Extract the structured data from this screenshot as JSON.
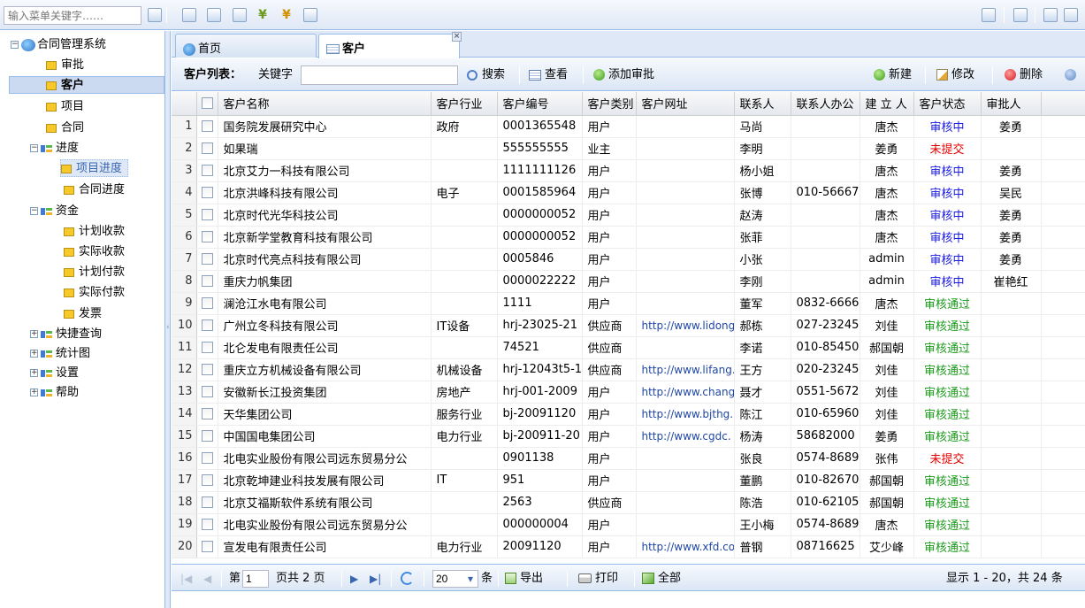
{
  "topbar": {
    "search_placeholder": "输入菜单关键字……"
  },
  "tree": {
    "root": "合同管理系统",
    "items": {
      "approval": "审批",
      "customer": "客户",
      "project": "项目",
      "contract": "合同",
      "progress": "进度",
      "project_progress": "项目进度",
      "contract_progress": "合同进度",
      "funds": "资金",
      "planned_receipt": "计划收款",
      "actual_receipt": "实际收款",
      "planned_payment": "计划付款",
      "actual_payment": "实际付款",
      "invoice": "发票",
      "quick_query": "快捷查询",
      "stats": "统计图",
      "settings": "设置",
      "help": "帮助"
    }
  },
  "tabs": {
    "home": "首页",
    "customer": "客户",
    "close_glyph": "×"
  },
  "gridbar": {
    "title": "客户列表：",
    "keyword_label": "关键字",
    "search": "搜索",
    "view": "查看",
    "add_approval": "添加审批",
    "create": "新建",
    "modify": "修改",
    "delete": "删除"
  },
  "grid": {
    "columns": [
      "客户名称",
      "客户行业",
      "客户编号",
      "客户类别",
      "客户网址",
      "联系人",
      "联系人办公",
      "建 立 人",
      "客户状态",
      "审批人"
    ],
    "rows": [
      [
        "国务院发展研究中心",
        "政府",
        "0001365548",
        "用户",
        "",
        "马尚",
        "",
        "唐杰",
        "审核中",
        "姜勇"
      ],
      [
        "如果瑞",
        "",
        "555555555",
        "业主",
        "",
        "李明",
        "",
        "姜勇",
        "未提交",
        ""
      ],
      [
        "北京艾力一科技有限公司",
        "",
        "1111111126",
        "用户",
        "",
        "杨小姐",
        "",
        "唐杰",
        "审核中",
        "姜勇"
      ],
      [
        "北京洪峰科技有限公司",
        "电子",
        "0001585964",
        "用户",
        "",
        "张博",
        "010-56667",
        "唐杰",
        "审核中",
        "吴民"
      ],
      [
        "北京时代光华科技公司",
        "",
        "0000000052",
        "用户",
        "",
        "赵涛",
        "",
        "唐杰",
        "审核中",
        "姜勇"
      ],
      [
        "北京新学堂教育科技有限公司",
        "",
        "0000000052",
        "用户",
        "",
        "张菲",
        "",
        "唐杰",
        "审核中",
        "姜勇"
      ],
      [
        "北京时代亮点科技有限公司",
        "",
        "0005846",
        "用户",
        "",
        "小张",
        "",
        "admin",
        "审核中",
        "姜勇"
      ],
      [
        "重庆力帆集团",
        "",
        "0000022222",
        "用户",
        "",
        "李刚",
        "",
        "admin",
        "审核中",
        "崔艳红"
      ],
      [
        "澜沧江水电有限公司",
        "",
        "1111",
        "用户",
        "",
        "董军",
        "0832-6666",
        "唐杰",
        "审核通过",
        ""
      ],
      [
        "广州立冬科技有限公司",
        "IT设备",
        "hrj-23025-21",
        "供应商",
        "http://www.lidong",
        "郝栋",
        "027-23245",
        "刘佳",
        "审核通过",
        ""
      ],
      [
        "北仑发电有限责任公司",
        "",
        "74521",
        "供应商",
        "",
        "李诺",
        "010-85450",
        "郝国朝",
        "审核通过",
        ""
      ],
      [
        "重庆立方机械设备有限公司",
        "机械设备",
        "hrj-12043t5-1",
        "供应商",
        "http://www.lifang.",
        "王方",
        "020-23245",
        "刘佳",
        "审核通过",
        ""
      ],
      [
        "安徽新长江投资集团",
        "房地产",
        "hrj-001-2009",
        "用户",
        "http://www.chang",
        "聂才",
        "0551-5672",
        "刘佳",
        "审核通过",
        ""
      ],
      [
        "天华集团公司",
        "服务行业",
        "bj-20091120",
        "用户",
        "http://www.bjthg.",
        "陈江",
        "010-65960",
        "刘佳",
        "审核通过",
        ""
      ],
      [
        "中国国电集团公司",
        "电力行业",
        "bj-200911-20",
        "用户",
        "http://www.cgdc.",
        "杨涛",
        "58682000",
        "姜勇",
        "审核通过",
        ""
      ],
      [
        "北电实业股份有限公司远东贸易分公",
        "",
        "0901138",
        "用户",
        "",
        "张良",
        "0574-8689",
        "张伟",
        "未提交",
        ""
      ],
      [
        "北京乾坤建业科技发展有限公司",
        "IT",
        "951",
        "用户",
        "",
        "董鹏",
        "010-82670",
        "郝国朝",
        "审核通过",
        ""
      ],
      [
        "北京艾福斯软件系统有限公司",
        "",
        "2563",
        "供应商",
        "",
        "陈浩",
        "010-62105",
        "郝国朝",
        "审核通过",
        ""
      ],
      [
        "北电实业股份有限公司远东贸易分公",
        "",
        "000000004",
        "用户",
        "",
        "王小梅",
        "0574-8689",
        "唐杰",
        "审核通过",
        ""
      ],
      [
        "宣发电有限责任公司",
        "电力行业",
        "20091120",
        "用户",
        "http://www.xfd.co",
        "普钢",
        "08716625",
        "艾少峰",
        "审核通过",
        ""
      ]
    ]
  },
  "pager": {
    "page_prefix": "第",
    "current_page": "1",
    "page_suffix": "页共 2 页",
    "page_size": "20",
    "size_suffix": "条",
    "export": "导出",
    "print": "打印",
    "all": "全部",
    "summary": "显示 1 - 20，共 24 条"
  },
  "colors": {
    "review": "#1a1ae6",
    "not_submitted": "#e60000",
    "passed": "#1a9a1a",
    "border": "#99bbe8"
  }
}
